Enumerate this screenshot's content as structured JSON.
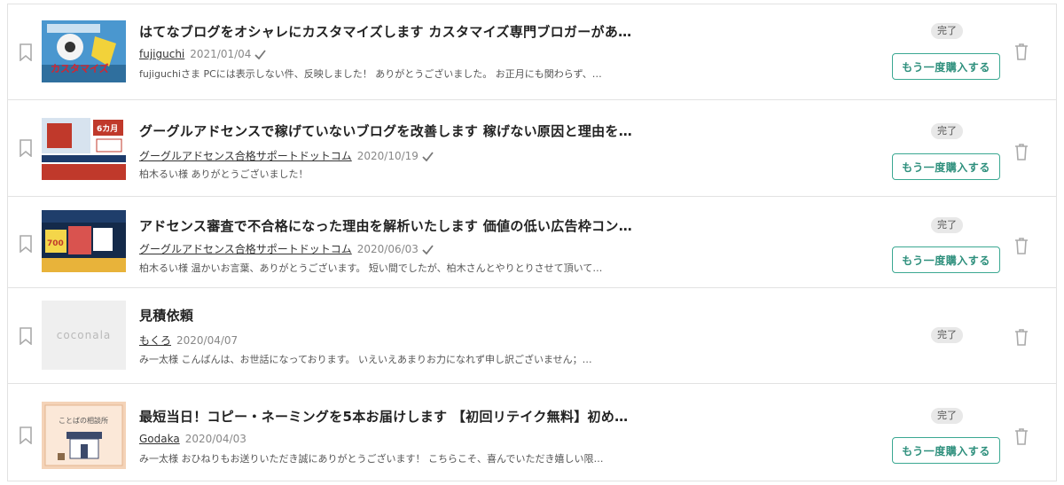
{
  "orders": [
    {
      "title": "はてなブログをオシャレにカスタマイズします カスタマイズ専門ブロガーがあな…",
      "seller": "fujiguchi",
      "date": "2021/01/04",
      "verified": true,
      "message": "fujiguchiさま PCには表示しない件、反映しました！ ありがとうございました。 お正月にも関わらず、…",
      "status": "完了",
      "rebuy_label": "もう一度購入する",
      "has_rebuy": true,
      "thumb_text": "カスタマイズ"
    },
    {
      "title": "グーグルアドセンスで稼げていないブログを改善します 稼げない原因と理由を解…",
      "seller": "グーグルアドセンス合格サポートドットコム",
      "date": "2020/10/19",
      "verified": true,
      "message": "柏木るい様 ありがとうございました！",
      "status": "完了",
      "rebuy_label": "もう一度購入する",
      "has_rebuy": true,
      "thumb_text": "6カ月"
    },
    {
      "title": "アドセンス審査で不合格になった理由を解析いたします 価値の低い広告枠コンテ…",
      "seller": "グーグルアドセンス合格サポートドットコム",
      "date": "2020/06/03",
      "verified": true,
      "message": "柏木るい様 温かいお言葉、ありがとうございます。 短い間でしたが、柏木さんとやりとりさせて頂いて…",
      "status": "完了",
      "rebuy_label": "もう一度購入する",
      "has_rebuy": true,
      "thumb_text": "700"
    },
    {
      "title": "見積依頼",
      "seller": "もくろ",
      "date": "2020/04/07",
      "verified": false,
      "message": "み一太様 こんばんは、お世話になっております。 いえいえあまりお力になれず申し訳ございません；…",
      "status": "完了",
      "rebuy_label": "",
      "has_rebuy": false,
      "thumb_text": "coconala"
    },
    {
      "title": "最短当日！コピー・ネーミングを5本お届けします 【初回リテイク無料】初めての…",
      "seller": "Godaka",
      "date": "2020/04/03",
      "verified": false,
      "message": "み一太様 おひねりもお送りいただき誠にありがとうございます！ こちらこそ、喜んでいただき嬉しい限…",
      "status": "完了",
      "rebuy_label": "もう一度購入する",
      "has_rebuy": true,
      "thumb_text": "ことばの相談所"
    }
  ],
  "colors": {
    "accent": "#3ba892",
    "border": "#e2e2e2",
    "badge_bg": "#e8e8e8"
  }
}
